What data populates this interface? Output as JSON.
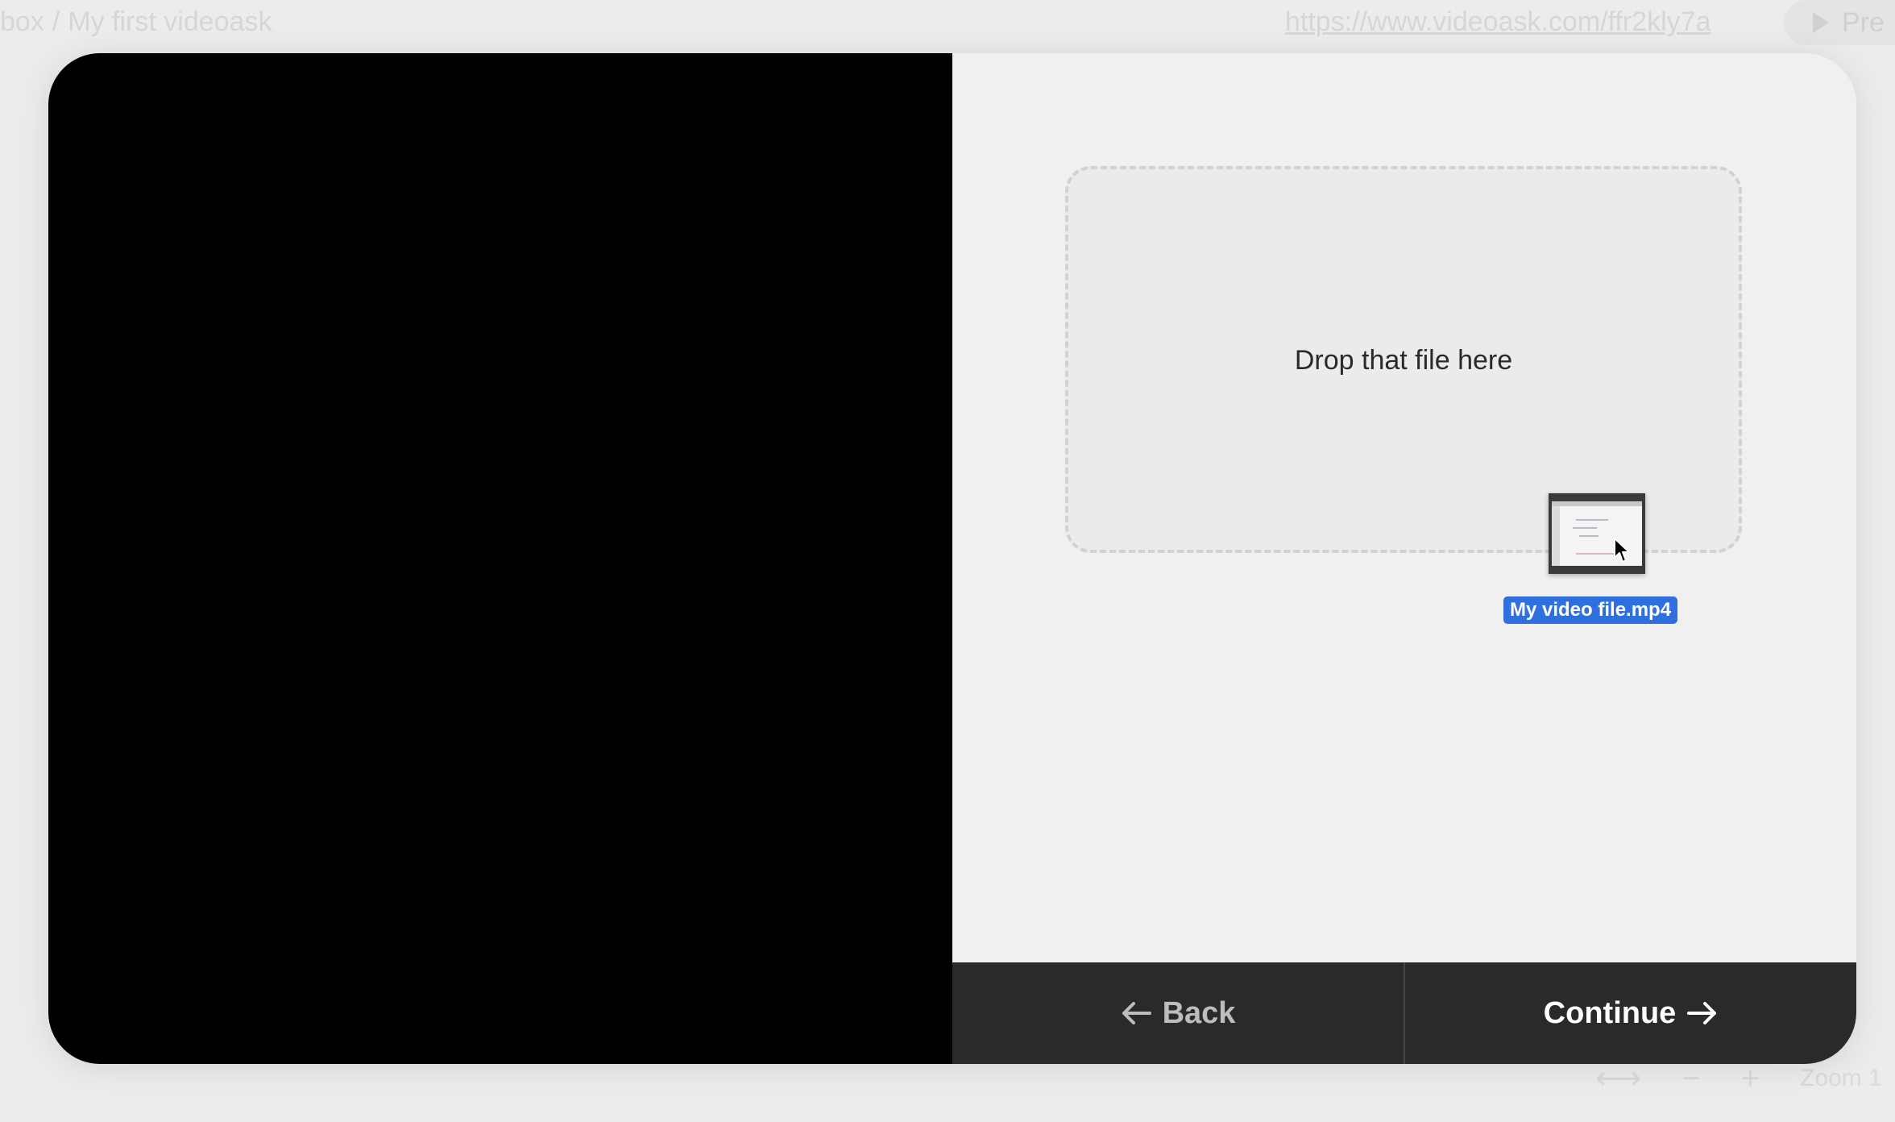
{
  "background": {
    "breadcrumb": {
      "parent": "box",
      "separator": "/",
      "current": "My first videoask"
    },
    "share_link": "https://www.videoask.com/ffr2kly7a",
    "preview_label": "Pre",
    "zoom_label": "Zoom 1"
  },
  "modal": {
    "dropzone": {
      "text": "Drop that file here"
    },
    "drag": {
      "file_name": "My video file.mp4"
    },
    "footer": {
      "back_label": "Back",
      "continue_label": "Continue"
    }
  },
  "colors": {
    "video_pane": "#000000",
    "footer_bg": "#2a2a2a",
    "file_label_bg": "#2f6fde"
  }
}
